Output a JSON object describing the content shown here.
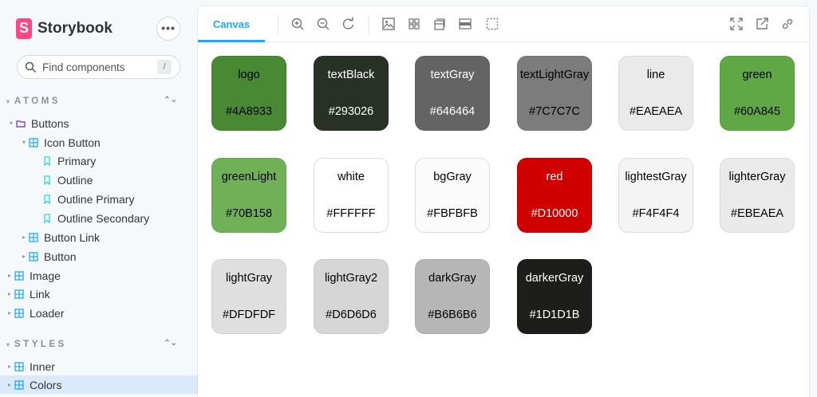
{
  "brand": {
    "logo_letter": "S",
    "name": "Storybook"
  },
  "sidebar": {
    "menu_label": "•••",
    "search": {
      "placeholder": "Find components",
      "shortcut": "/"
    },
    "groups": [
      {
        "title": "ATOMS"
      },
      {
        "title": "STYLES"
      }
    ],
    "items": [
      {
        "label": "Buttons"
      },
      {
        "label": "Icon Button"
      },
      {
        "label": "Primary"
      },
      {
        "label": "Outline"
      },
      {
        "label": "Outline Primary"
      },
      {
        "label": "Outline Secondary"
      },
      {
        "label": "Button Link"
      },
      {
        "label": "Button"
      },
      {
        "label": "Image"
      },
      {
        "label": "Link"
      },
      {
        "label": "Loader"
      },
      {
        "label": "Inner"
      },
      {
        "label": "Colors"
      }
    ]
  },
  "toolbar": {
    "tab_label": "Canvas"
  },
  "swatches": [
    {
      "name": "logo",
      "hex": "#4A8933",
      "bg": "#4A8933",
      "fg": "#000000"
    },
    {
      "name": "textBlack",
      "hex": "#293026",
      "bg": "#293026",
      "fg": "#ffffff"
    },
    {
      "name": "textGray",
      "hex": "#646464",
      "bg": "#646464",
      "fg": "#ffffff"
    },
    {
      "name": "textLightGray",
      "hex": "#7C7C7C",
      "bg": "#7C7C7C",
      "fg": "#000000"
    },
    {
      "name": "line",
      "hex": "#EAEAEA",
      "bg": "#EAEAEA",
      "fg": "#000000"
    },
    {
      "name": "green",
      "hex": "#60A845",
      "bg": "#60A845",
      "fg": "#000000"
    },
    {
      "name": "greenLight",
      "hex": "#70B158",
      "bg": "#70B158",
      "fg": "#000000"
    },
    {
      "name": "white",
      "hex": "#FFFFFF",
      "bg": "#FFFFFF",
      "fg": "#000000"
    },
    {
      "name": "bgGray",
      "hex": "#FBFBFB",
      "bg": "#FBFBFB",
      "fg": "#000000"
    },
    {
      "name": "red",
      "hex": "#D10000",
      "bg": "#D10000",
      "fg": "#ffffff"
    },
    {
      "name": "lightestGray",
      "hex": "#F4F4F4",
      "bg": "#F4F4F4",
      "fg": "#000000"
    },
    {
      "name": "lighterGray",
      "hex": "#EBEAEA",
      "bg": "#EBEAEA",
      "fg": "#000000"
    },
    {
      "name": "lightGray",
      "hex": "#DFDFDF",
      "bg": "#DFDFDF",
      "fg": "#000000"
    },
    {
      "name": "lightGray2",
      "hex": "#D6D6D6",
      "bg": "#D6D6D6",
      "fg": "#000000"
    },
    {
      "name": "darkGray",
      "hex": "#B6B6B6",
      "bg": "#B6B6B6",
      "fg": "#000000"
    },
    {
      "name": "darkerGray",
      "hex": "#1D1D1B",
      "bg": "#1D1D1B",
      "fg": "#ffffff"
    }
  ],
  "colors": {
    "accent": "#1ea7fd",
    "brand": "#ff4785",
    "selected_bg": "#dbeafb"
  }
}
